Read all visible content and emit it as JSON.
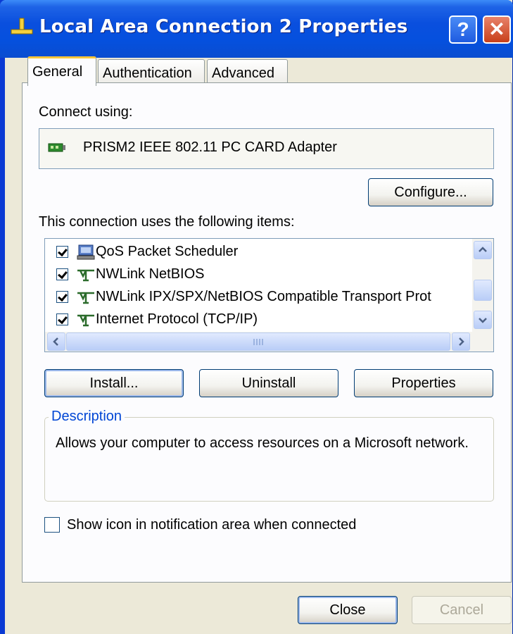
{
  "window": {
    "title": "Local Area Connection 2 Properties",
    "help_glyph": "?",
    "close_glyph": "✕"
  },
  "tabs": [
    {
      "label": "General",
      "active": true
    },
    {
      "label": "Authentication",
      "active": false
    },
    {
      "label": "Advanced",
      "active": false
    }
  ],
  "general": {
    "connect_using_label": "Connect using:",
    "adapter_name": "PRISM2 IEEE 802.11 PC CARD Adapter",
    "configure_button": "Configure...",
    "items_label": "This connection uses the following items:",
    "items": [
      {
        "label": "QoS Packet Scheduler",
        "checked": true,
        "icon": "scheduler-icon"
      },
      {
        "label": "NWLink NetBIOS",
        "checked": true,
        "icon": "protocol-icon"
      },
      {
        "label": "NWLink IPX/SPX/NetBIOS Compatible Transport Prot",
        "checked": true,
        "icon": "protocol-icon"
      },
      {
        "label": "Internet Protocol (TCP/IP)",
        "checked": true,
        "icon": "protocol-icon"
      }
    ],
    "install_button": "Install...",
    "uninstall_button": "Uninstall",
    "properties_button": "Properties",
    "description_legend": "Description",
    "description_text": "Allows your computer to access resources on a Microsoft network.",
    "notify_checkbox_label": "Show icon in notification area when connected",
    "notify_checked": false
  },
  "footer": {
    "close_button": "Close",
    "cancel_button": "Cancel"
  },
  "colors": {
    "title_bar": "#0A4FDE",
    "dialog_bg": "#ECE9D8",
    "tab_highlight": "#FFC83C",
    "group_legend": "#0046D5"
  }
}
